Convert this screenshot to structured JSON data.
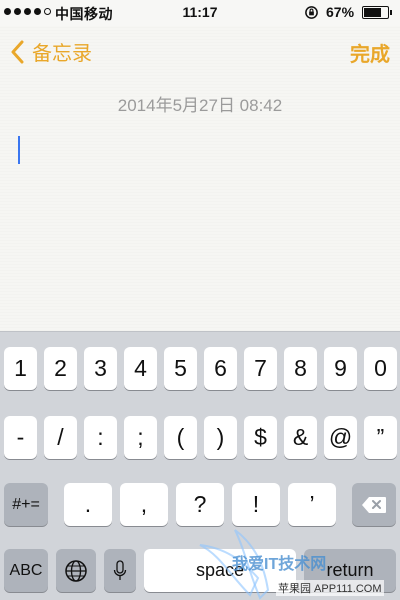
{
  "status_bar": {
    "carrier": "中国移动",
    "time": "11:17",
    "battery_percent": "67%",
    "signal_dots": [
      true,
      true,
      true,
      true,
      false
    ],
    "battery_level": 0.67
  },
  "nav": {
    "back_label": "备忘录",
    "done_label": "完成",
    "accent_color": "#e9a72a"
  },
  "note": {
    "date": "2014年5月27日 08:42",
    "cursor_color": "#3a76f0"
  },
  "keyboard": {
    "row1": [
      "1",
      "2",
      "3",
      "4",
      "5",
      "6",
      "7",
      "8",
      "9",
      "0"
    ],
    "row2": [
      "-",
      "/",
      ":",
      ";",
      "(",
      ")",
      "$",
      "&",
      "@",
      "”"
    ],
    "row3_shift": "#+=",
    "row3": [
      ".",
      ",",
      "?",
      "!",
      "’"
    ],
    "row3_delete_icon": "backspace-icon",
    "row4_abc": "ABC",
    "row4_globe_icon": "globe-icon",
    "row4_mic_icon": "microphone-icon",
    "row4_space": "space",
    "row4_return": "return"
  },
  "watermark": {
    "text": "我爱IT技术网",
    "subtext": "苹果园 APP111.COM"
  }
}
